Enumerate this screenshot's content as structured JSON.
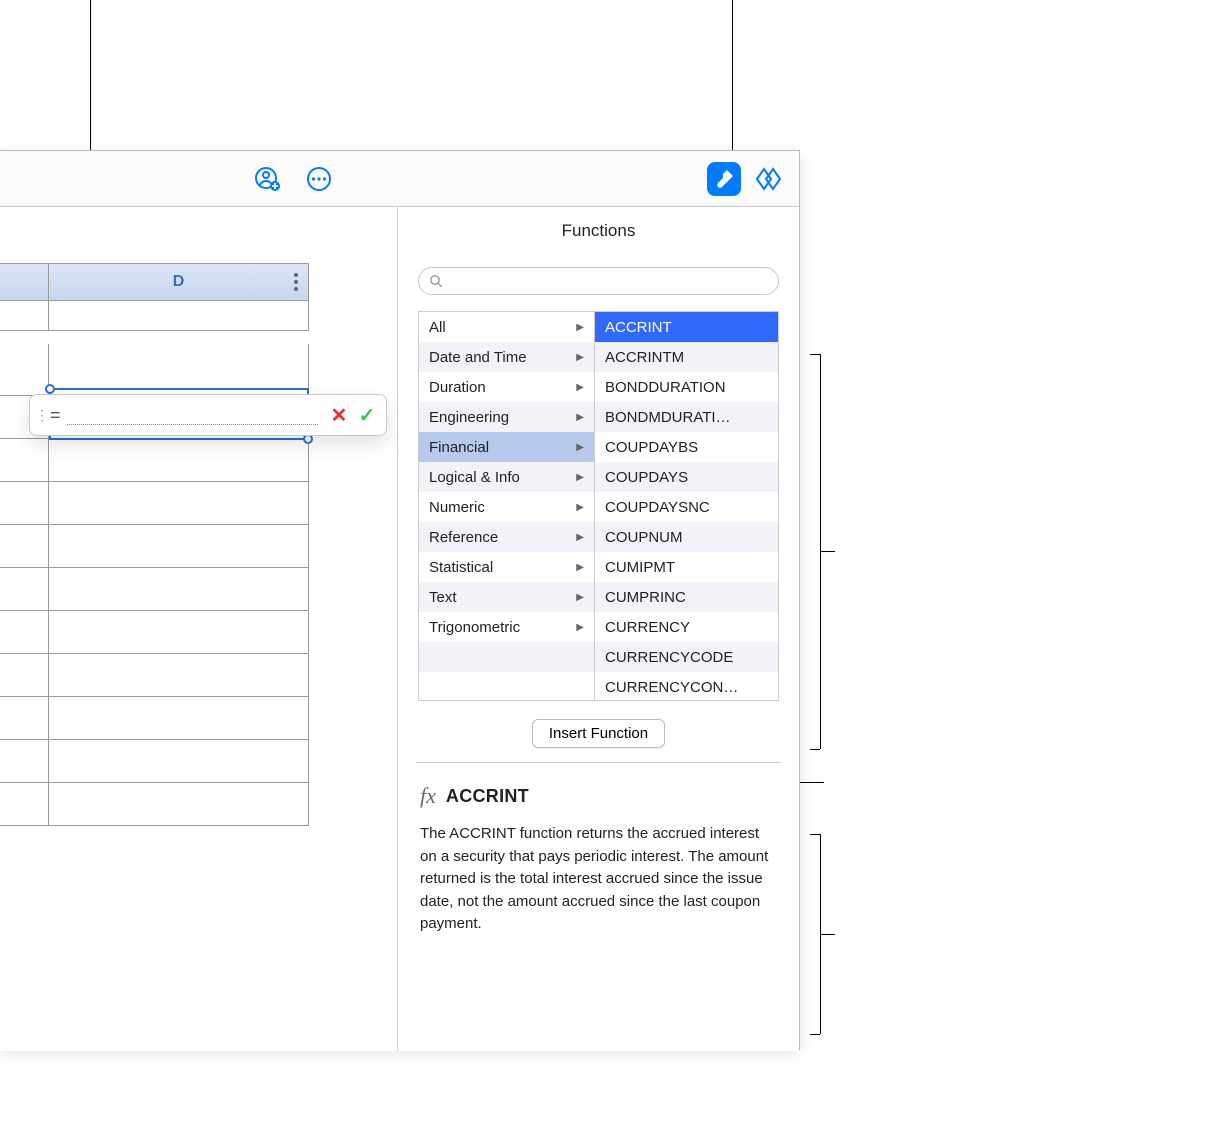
{
  "toolbar": {
    "collaborate_icon": "collaborate",
    "more_icon": "more",
    "format_icon": "format-paintbrush",
    "organize_icon": "organize-diamonds"
  },
  "sheet": {
    "column_label": "D"
  },
  "formula_editor": {
    "eq": "=",
    "value": ""
  },
  "functions_panel": {
    "title": "Functions",
    "search_placeholder": "",
    "categories": [
      "All",
      "Date and Time",
      "Duration",
      "Engineering",
      "Financial",
      "Logical & Info",
      "Numeric",
      "Reference",
      "Statistical",
      "Text",
      "Trigonometric"
    ],
    "selected_category_index": 4,
    "functions": [
      "ACCRINT",
      "ACCRINTM",
      "BONDDURATION",
      "BONDMDURATI…",
      "COUPDAYBS",
      "COUPDAYS",
      "COUPDAYSNC",
      "COUPNUM",
      "CUMIPMT",
      "CUMPRINC",
      "CURRENCY",
      "CURRENCYCODE",
      "CURRENCYCON…"
    ],
    "selected_function_index": 0,
    "insert_label": "Insert Function",
    "detail": {
      "fx": "fx",
      "name": "ACCRINT",
      "description": "The ACCRINT function returns the accrued interest on a security that pays periodic interest. The amount returned is the total interest accrued since the issue date, not the amount accrued since the last coupon payment."
    }
  }
}
